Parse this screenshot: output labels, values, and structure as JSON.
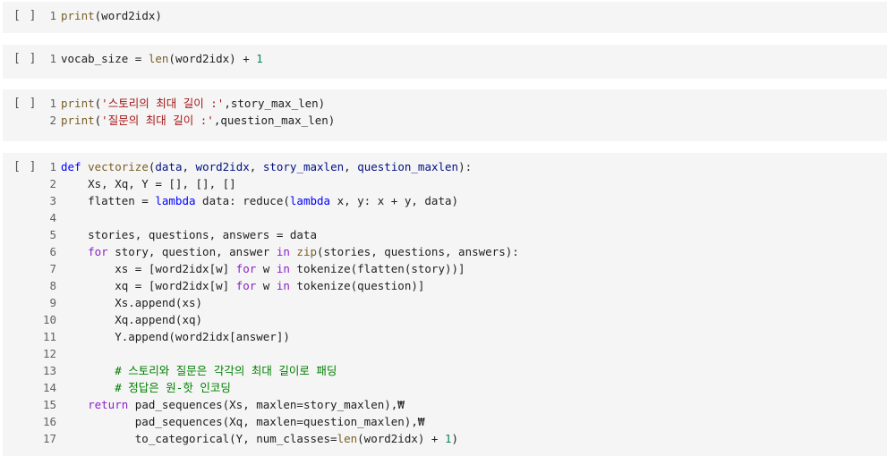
{
  "run_label": "[ ]",
  "cells": [
    {
      "lines": [
        {
          "n": "1",
          "t": [
            [
              "print",
              "fn"
            ],
            [
              "(word2idx)",
              ""
            ]
          ]
        }
      ]
    },
    {
      "lines": [
        {
          "n": "1",
          "t": [
            [
              "vocab_size = ",
              ""
            ],
            [
              "len",
              "fn"
            ],
            [
              "(word2idx) + ",
              ""
            ],
            [
              "1",
              "num"
            ]
          ]
        }
      ]
    },
    {
      "lines": [
        {
          "n": "1",
          "t": [
            [
              "print",
              "fn"
            ],
            [
              "(",
              ""
            ],
            [
              "'스토리의 최대 길이 :'",
              "str"
            ],
            [
              ",story_max_len)",
              ""
            ]
          ]
        },
        {
          "n": "2",
          "t": [
            [
              "print",
              "fn"
            ],
            [
              "(",
              ""
            ],
            [
              "'질문의 최대 길이 :'",
              "str"
            ],
            [
              ",question_max_len)",
              ""
            ]
          ]
        }
      ]
    },
    {
      "lines": [
        {
          "n": "1",
          "t": [
            [
              "def ",
              "bl"
            ],
            [
              "vectorize",
              "fn"
            ],
            [
              "(",
              ""
            ],
            [
              "data",
              "pm"
            ],
            [
              ", ",
              ""
            ],
            [
              "word2idx",
              "pm"
            ],
            [
              ", ",
              ""
            ],
            [
              "story_maxlen",
              "pm"
            ],
            [
              ", ",
              ""
            ],
            [
              "question_maxlen",
              "pm"
            ],
            [
              "):",
              ""
            ]
          ]
        },
        {
          "n": "2",
          "t": [
            [
              "    Xs, Xq, Y = [], [], []",
              ""
            ]
          ]
        },
        {
          "n": "3",
          "t": [
            [
              "    flatten = ",
              ""
            ],
            [
              "lambda ",
              "bl"
            ],
            [
              "data: reduce(",
              ""
            ],
            [
              "lambda ",
              "bl"
            ],
            [
              "x, y: x + y, data)",
              ""
            ]
          ]
        },
        {
          "n": "4",
          "t": []
        },
        {
          "n": "5",
          "t": [
            [
              "    stories, questions, answers = data",
              ""
            ]
          ]
        },
        {
          "n": "6",
          "t": [
            [
              "    ",
              ""
            ],
            [
              "for ",
              "kw"
            ],
            [
              "story, question, answer ",
              ""
            ],
            [
              "in ",
              "kw"
            ],
            [
              "zip",
              "fn"
            ],
            [
              "(stories, questions, answers):",
              ""
            ]
          ]
        },
        {
          "n": "7",
          "t": [
            [
              "        xs = [word2idx[w] ",
              ""
            ],
            [
              "for ",
              "kw"
            ],
            [
              "w ",
              ""
            ],
            [
              "in ",
              "kw"
            ],
            [
              "tokenize(flatten(story))]",
              ""
            ]
          ]
        },
        {
          "n": "8",
          "t": [
            [
              "        xq = [word2idx[w] ",
              ""
            ],
            [
              "for ",
              "kw"
            ],
            [
              "w ",
              ""
            ],
            [
              "in ",
              "kw"
            ],
            [
              "tokenize(question)]",
              ""
            ]
          ]
        },
        {
          "n": "9",
          "t": [
            [
              "        Xs.append(xs)",
              ""
            ]
          ]
        },
        {
          "n": "10",
          "t": [
            [
              "        Xq.append(xq)",
              ""
            ]
          ]
        },
        {
          "n": "11",
          "t": [
            [
              "        Y.append(word2idx[answer])",
              ""
            ]
          ]
        },
        {
          "n": "12",
          "t": []
        },
        {
          "n": "13",
          "t": [
            [
              "        ",
              ""
            ],
            [
              "# 스토리와 질문은 각각의 최대 길이로 패딩",
              "cm"
            ]
          ]
        },
        {
          "n": "14",
          "t": [
            [
              "        ",
              ""
            ],
            [
              "# 정답은 원-핫 인코딩",
              "cm"
            ]
          ]
        },
        {
          "n": "15",
          "t": [
            [
              "    ",
              ""
            ],
            [
              "return ",
              "kw"
            ],
            [
              "pad_sequences(Xs, maxlen=story_maxlen),₩",
              ""
            ]
          ]
        },
        {
          "n": "16",
          "t": [
            [
              "           pad_sequences(Xq, maxlen=question_maxlen),₩",
              ""
            ]
          ]
        },
        {
          "n": "17",
          "t": [
            [
              "           to_categorical(Y, num_classes=",
              ""
            ],
            [
              "len",
              "fn"
            ],
            [
              "(word2idx) + ",
              ""
            ],
            [
              "1",
              "num"
            ],
            [
              ")",
              ""
            ]
          ]
        }
      ]
    }
  ]
}
